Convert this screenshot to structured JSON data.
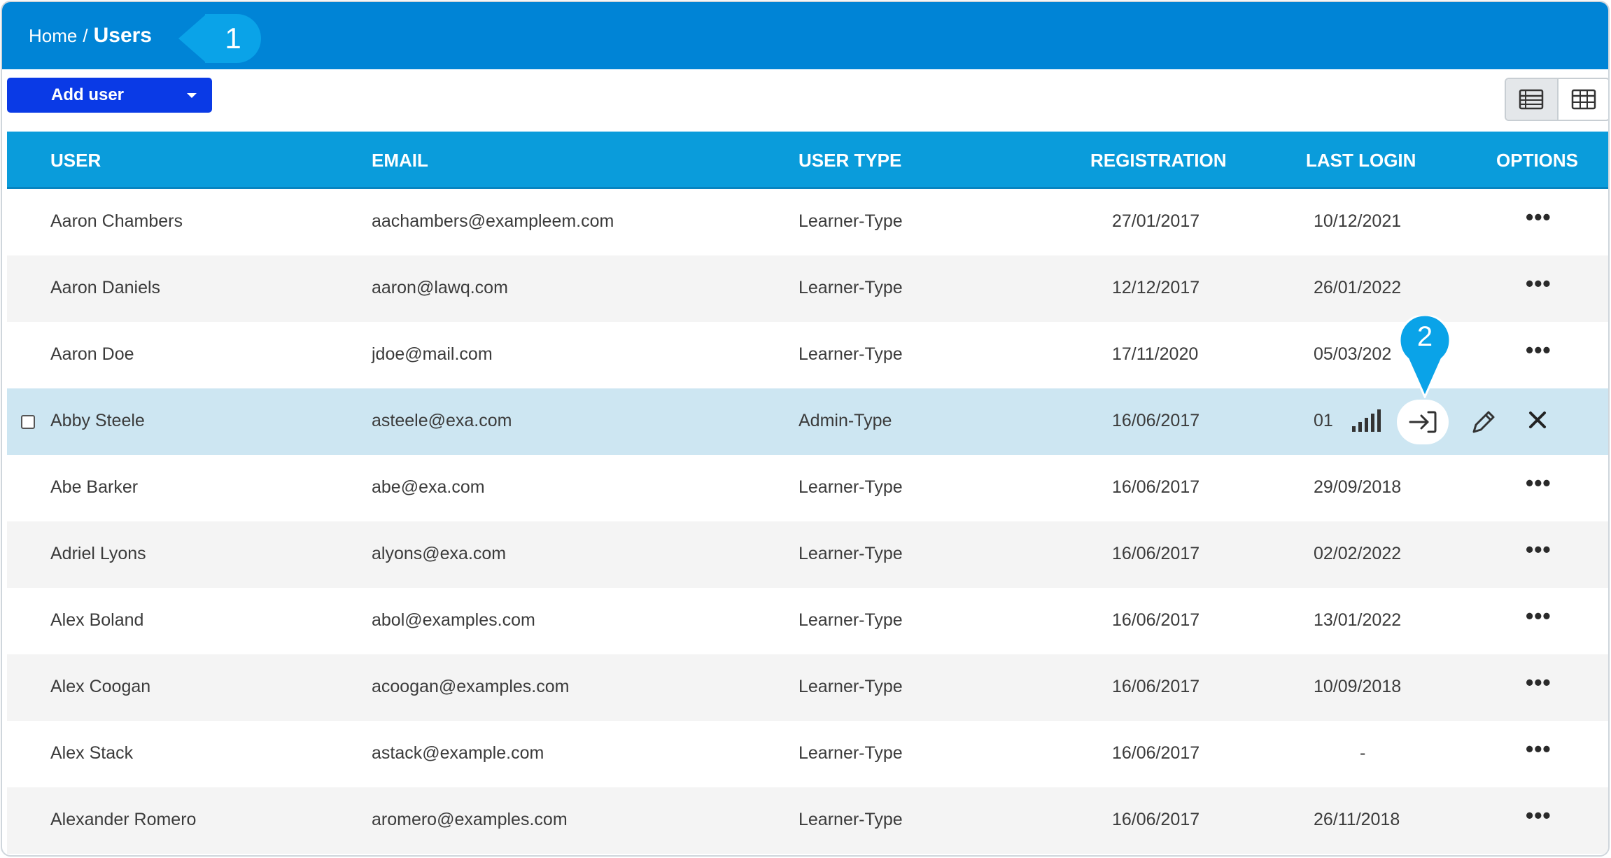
{
  "breadcrumb": {
    "home": "Home",
    "separator": "/",
    "current": "Users"
  },
  "callouts": {
    "first": "1",
    "second": "2"
  },
  "toolbar": {
    "add_user_label": "Add user",
    "view_list_icon": "list-view-icon",
    "view_grid_icon": "grid-view-icon"
  },
  "table": {
    "headers": {
      "user": "USER",
      "email": "EMAIL",
      "user_type": "USER TYPE",
      "registration": "REGISTRATION",
      "last_login": "LAST LOGIN",
      "options": "OPTIONS"
    },
    "rows": [
      {
        "user": "Aaron Chambers",
        "email": "aachambers@exampleem.com",
        "type": "Learner-Type",
        "registration": "27/01/2017",
        "last_login": "10/12/2021"
      },
      {
        "user": "Aaron Daniels",
        "email": "aaron@lawq.com",
        "type": "Learner-Type",
        "registration": "12/12/2017",
        "last_login": "26/01/2022"
      },
      {
        "user": "Aaron Doe",
        "email": "jdoe@mail.com",
        "type": "Learner-Type",
        "registration": "17/11/2020",
        "last_login": "05/03/202"
      },
      {
        "user": "Abby Steele",
        "email": "asteele@exa.com",
        "type": "Admin-Type",
        "registration": "16/06/2017",
        "last_login": "01"
      },
      {
        "user": "Abe Barker",
        "email": "abe@exa.com",
        "type": "Learner-Type",
        "registration": "16/06/2017",
        "last_login": "29/09/2018"
      },
      {
        "user": "Adriel Lyons",
        "email": "alyons@exa.com",
        "type": "Learner-Type",
        "registration": "16/06/2017",
        "last_login": "02/02/2022"
      },
      {
        "user": "Alex Boland",
        "email": "abol@examples.com",
        "type": "Learner-Type",
        "registration": "16/06/2017",
        "last_login": "13/01/2022"
      },
      {
        "user": "Alex Coogan",
        "email": "acoogan@examples.com",
        "type": "Learner-Type",
        "registration": "16/06/2017",
        "last_login": "10/09/2018"
      },
      {
        "user": "Alex Stack",
        "email": "astack@example.com",
        "type": "Learner-Type",
        "registration": "16/06/2017",
        "last_login": "-"
      },
      {
        "user": "Alexander Romero",
        "email": "aromero@examples.com",
        "type": "Learner-Type",
        "registration": "16/06/2017",
        "last_login": "26/11/2018"
      }
    ],
    "options_label": "•••"
  },
  "colors": {
    "topbar": "#0084d6",
    "table_header": "#0a9cdb",
    "add_user_button": "#0a3ae6",
    "row_highlight": "#cde6f2",
    "callout": "#0aa3e8"
  }
}
